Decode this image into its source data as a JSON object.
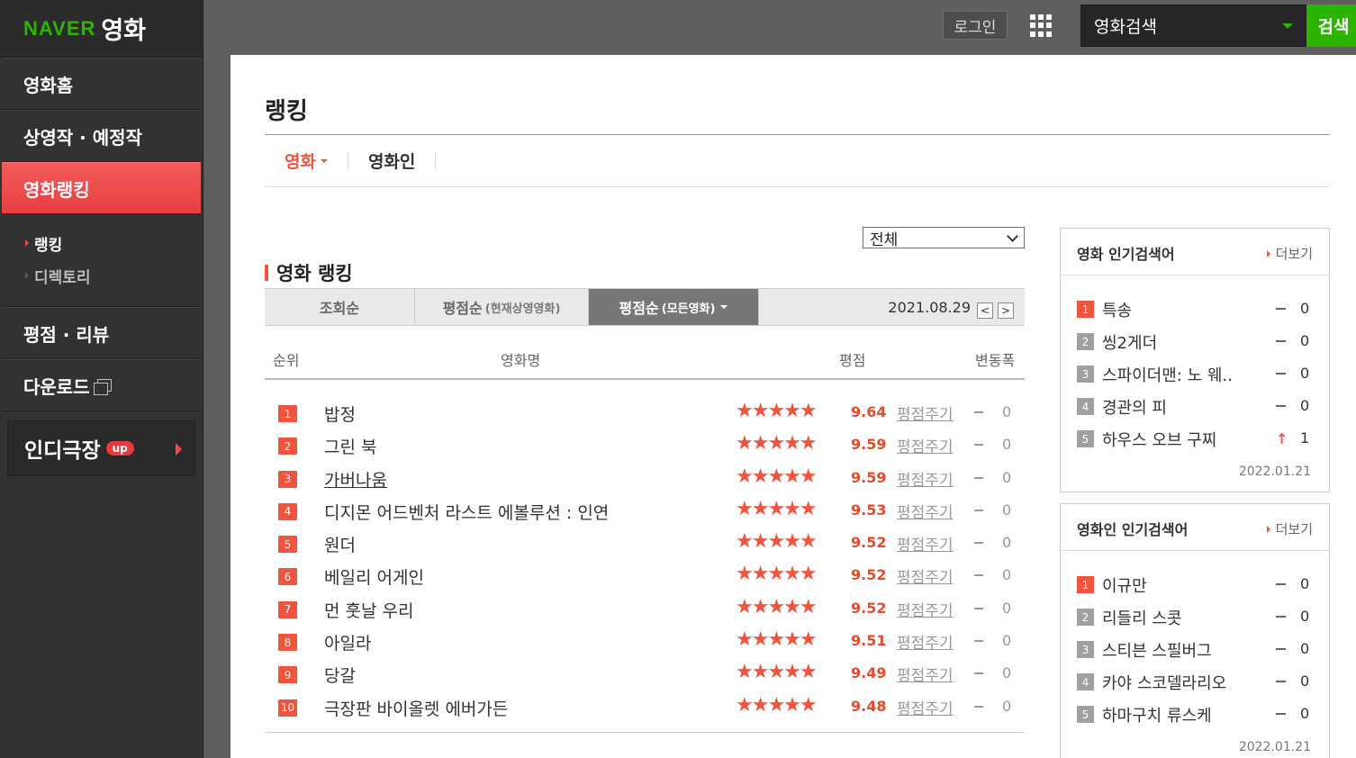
{
  "brand": {
    "naver": "NAVER",
    "service": "영화"
  },
  "sidebar": {
    "items": [
      {
        "label": "영화홈"
      },
      {
        "label": "상영작 · 예정작"
      },
      {
        "label": "영화랭킹"
      }
    ],
    "sub_items": [
      {
        "label": "랭킹"
      },
      {
        "label": "디렉토리"
      }
    ],
    "items_after": [
      {
        "label": "평점 · 리뷰"
      },
      {
        "label": "다운로드"
      }
    ],
    "indie": {
      "label": "인디극장",
      "badge": "up"
    }
  },
  "topbar": {
    "login_label": "로그인",
    "search_scope": "영화검색",
    "search_button": "검색"
  },
  "page": {
    "title": "랭킹",
    "tabs": [
      {
        "label": "영화"
      },
      {
        "label": "영화인"
      }
    ],
    "filter_value": "전체",
    "section_title": "영화 랭킹",
    "sort_tabs": [
      {
        "label": "조회순",
        "sub": ""
      },
      {
        "label": "평점순",
        "sub": "(현재상영영화)"
      },
      {
        "label": "평점순",
        "sub": "(모든영화)"
      }
    ],
    "date": "2021.08.29",
    "date_prev": "<",
    "date_next": ">",
    "columns": {
      "rank": "순위",
      "title": "영화명",
      "rating": "평점",
      "change": "변동폭"
    }
  },
  "rankings": [
    {
      "rank": "1",
      "title": "밥정",
      "score": "9.64",
      "rate": "평점주기",
      "change": "0"
    },
    {
      "rank": "2",
      "title": "그린 북",
      "score": "9.59",
      "rate": "평점주기",
      "change": "0"
    },
    {
      "rank": "3",
      "title": "가버나움",
      "score": "9.59",
      "rate": "평점주기",
      "change": "0"
    },
    {
      "rank": "4",
      "title": "디지몬 어드벤처 라스트 에볼루션 : 인연",
      "score": "9.53",
      "rate": "평점주기",
      "change": "0"
    },
    {
      "rank": "5",
      "title": "원더",
      "score": "9.52",
      "rate": "평점주기",
      "change": "0"
    },
    {
      "rank": "6",
      "title": "베일리 어게인",
      "score": "9.52",
      "rate": "평점주기",
      "change": "0"
    },
    {
      "rank": "7",
      "title": "먼 훗날 우리",
      "score": "9.52",
      "rate": "평점주기",
      "change": "0"
    },
    {
      "rank": "8",
      "title": "아일라",
      "score": "9.51",
      "rate": "평점주기",
      "change": "0"
    },
    {
      "rank": "9",
      "title": "당갈",
      "score": "9.49",
      "rate": "평점주기",
      "change": "0"
    },
    {
      "rank": "10",
      "title": "극장판 바이올렛 에버가든",
      "score": "9.48",
      "rate": "평점주기",
      "change": "0"
    }
  ],
  "stars_glyph": "★★★★★",
  "widgets": {
    "movie_search": {
      "title": "영화 인기검색어",
      "more": "더보기",
      "items": [
        {
          "rank": "1",
          "name": "특송",
          "trend": "same",
          "value": "0"
        },
        {
          "rank": "2",
          "name": "씽2게더",
          "trend": "same",
          "value": "0"
        },
        {
          "rank": "3",
          "name": "스파이더맨: 노 웨..",
          "trend": "same",
          "value": "0"
        },
        {
          "rank": "4",
          "name": "경관의 피",
          "trend": "same",
          "value": "0"
        },
        {
          "rank": "5",
          "name": "하우스 오브 구찌",
          "trend": "up",
          "value": "1"
        }
      ],
      "date": "2022.01.21"
    },
    "person_search": {
      "title": "영화인 인기검색어",
      "more": "더보기",
      "items": [
        {
          "rank": "1",
          "name": "이규만",
          "trend": "same",
          "value": "0"
        },
        {
          "rank": "2",
          "name": "리들리 스콧",
          "trend": "same",
          "value": "0"
        },
        {
          "rank": "3",
          "name": "스티븐 스필버그",
          "trend": "same",
          "value": "0"
        },
        {
          "rank": "4",
          "name": "카야 스코델라리오",
          "trend": "same",
          "value": "0"
        },
        {
          "rank": "5",
          "name": "하마구치 류스케",
          "trend": "same",
          "value": "0"
        }
      ],
      "date": "2022.01.21"
    }
  },
  "colors": {
    "accent": "#f1543d",
    "naver_green": "#2db400",
    "sidebar_active": "#f2494b"
  }
}
